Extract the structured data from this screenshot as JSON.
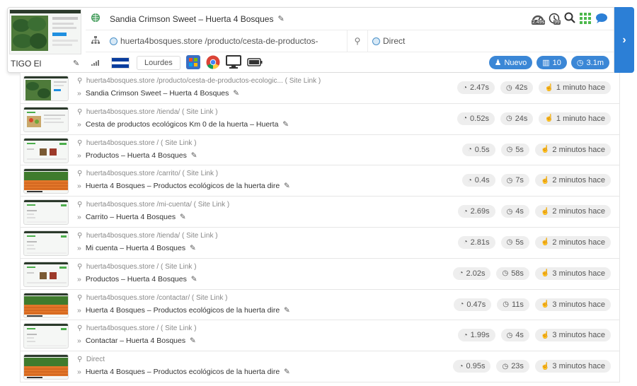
{
  "header": {
    "device_label": "TIGO El",
    "page_title": "Sandia Crimson Sweet – Huerta 4 Bosques",
    "url": "huerta4bosques.store /producto/cesta-de-productos-",
    "referrer": "Direct",
    "city": "Lourdes",
    "badge_new": "Nuevo",
    "badge_pages": "10",
    "badge_time": "3.1m",
    "speed_badge": "2.49s",
    "clock_badge": "99",
    "flag_colors": [
      "#0a3d9e",
      "#ffffff",
      "#0a3d9e"
    ],
    "accent": "#2c7fd6"
  },
  "visits": [
    {
      "link": "huerta4bosques.store /producto/cesta-de-productos-ecologic... ( Site Link )",
      "title": "Sandia Crimson Sweet – Huerta 4 Bosques",
      "speed": "2.47s",
      "duration": "42s",
      "ago": "1 minuto hace",
      "thumb": "melon"
    },
    {
      "link": "huerta4bosques.store /tienda/ ( Site Link )",
      "title": "Cesta de productos ecológicos Km 0 de la huerta – Huerta",
      "speed": "0.52s",
      "duration": "24s",
      "ago": "1 minuto hace",
      "thumb": "shop"
    },
    {
      "link": "huerta4bosques.store / ( Site Link )",
      "title": "Productos – Huerta 4 Bosques",
      "speed": "0.5s",
      "duration": "5s",
      "ago": "2 minutos hace",
      "thumb": "products"
    },
    {
      "link": "huerta4bosques.store /carrito/ ( Site Link )",
      "title": "Huerta 4 Bosques – Productos ecológicos de la huerta dire",
      "speed": "0.4s",
      "duration": "7s",
      "ago": "2 minutos hace",
      "thumb": "carrots"
    },
    {
      "link": "huerta4bosques.store /mi-cuenta/ ( Site Link )",
      "title": "Carrito – Huerta 4 Bosques",
      "speed": "2.69s",
      "duration": "4s",
      "ago": "2 minutos hace",
      "thumb": "blank"
    },
    {
      "link": "huerta4bosques.store /tienda/ ( Site Link )",
      "title": "Mi cuenta – Huerta 4 Bosques",
      "speed": "2.81s",
      "duration": "5s",
      "ago": "2 minutos hace",
      "thumb": "blank"
    },
    {
      "link": "huerta4bosques.store / ( Site Link )",
      "title": "Productos – Huerta 4 Bosques",
      "speed": "2.02s",
      "duration": "58s",
      "ago": "3 minutos hace",
      "thumb": "products"
    },
    {
      "link": "huerta4bosques.store /contactar/ ( Site Link )",
      "title": "Huerta 4 Bosques – Productos ecológicos de la huerta dire",
      "speed": "0.47s",
      "duration": "11s",
      "ago": "3 minutos hace",
      "thumb": "carrots"
    },
    {
      "link": "huerta4bosques.store / ( Site Link )",
      "title": "Contactar – Huerta 4 Bosques",
      "speed": "1.99s",
      "duration": "4s",
      "ago": "3 minutos hace",
      "thumb": "blank"
    },
    {
      "link": "Direct",
      "title": "Huerta 4 Bosques – Productos ecológicos de la huerta dire",
      "speed": "0.95s",
      "duration": "23s",
      "ago": "3 minutos hace",
      "thumb": "carrots"
    }
  ]
}
